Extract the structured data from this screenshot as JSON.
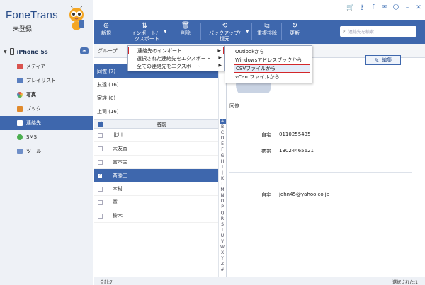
{
  "app": {
    "title": "FoneTrans",
    "subtitle": "未登録"
  },
  "device": {
    "name": "iPhone 5s"
  },
  "sidebar": {
    "items": [
      {
        "label": "メディア",
        "color": "#d9534f"
      },
      {
        "label": "プレイリスト",
        "color": "#5a7fc0"
      },
      {
        "label": "写真",
        "color": "#e2a531"
      },
      {
        "label": "ブック",
        "color": "#e08a2c"
      },
      {
        "label": "連絡先",
        "color": "#ffffff"
      },
      {
        "label": "SMS",
        "color": "#4caf50"
      },
      {
        "label": "ツール",
        "color": "#6f8fc8"
      }
    ]
  },
  "toolbar": {
    "new_label": "新規",
    "import_export_label1": "インポート/",
    "import_export_label2": "エクスポート",
    "delete_label": "削除",
    "backup_label1": "バックアップ/",
    "backup_label2": "復元",
    "dedupe_label": "重複排除",
    "refresh_label": "更新",
    "search_placeholder": "連絡先を検索"
  },
  "groups_header": "グループ",
  "groups": [
    {
      "label": "同僚 (7)"
    },
    {
      "label": "友達 (16)"
    },
    {
      "label": "家族 (0)"
    },
    {
      "label": "上司 (16)"
    }
  ],
  "contacts_header": "名前",
  "contacts": [
    {
      "name": "北川"
    },
    {
      "name": "大友香"
    },
    {
      "name": "宮本宝"
    },
    {
      "name": "斉藤工"
    },
    {
      "name": "木村"
    },
    {
      "name": "童"
    },
    {
      "name": "鈴木"
    }
  ],
  "alphabet": [
    "A",
    "B",
    "C",
    "D",
    "E",
    "F",
    "G",
    "H",
    "I",
    "J",
    "K",
    "L",
    "M",
    "N",
    "O",
    "P",
    "Q",
    "R",
    "S",
    "T",
    "U",
    "V",
    "W",
    "X",
    "Y",
    "Z",
    "#"
  ],
  "detail": {
    "edit_label": "編集",
    "group": "同僚",
    "phone_home_label": "自宅",
    "phone_home_value": "0110255435",
    "phone_mobile_label": "携帯",
    "phone_mobile_value": "13024465621",
    "email_home_label": "自宅",
    "email_home_value": "john45@yahoo.co.jp"
  },
  "menu_main": [
    {
      "label": "連絡先のインポート"
    },
    {
      "label": "選択された連絡先をエクスポート"
    },
    {
      "label": "全ての連絡先をエクスポート"
    }
  ],
  "menu_sub": [
    {
      "label": "Outlookから"
    },
    {
      "label": "Windowsアドレスブックから"
    },
    {
      "label": "CSVファイルから"
    },
    {
      "label": "vCardファイルから"
    }
  ],
  "status": {
    "total": "合計:7",
    "selected": "選択された:1"
  },
  "colors": {
    "accent": "#3e67ad",
    "highlight_border": "#d3272a"
  }
}
